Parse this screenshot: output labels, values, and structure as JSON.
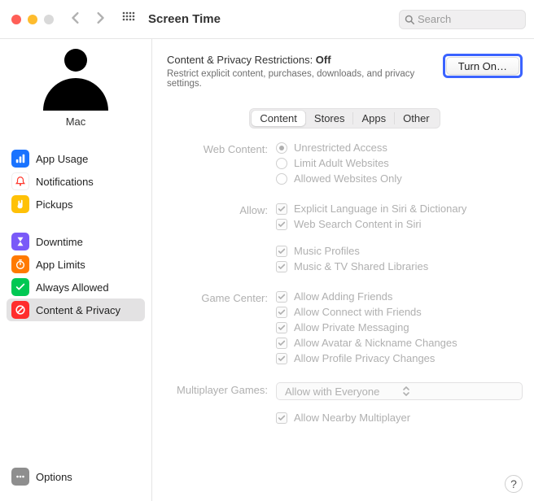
{
  "toolbar": {
    "title": "Screen Time",
    "search_placeholder": "Search"
  },
  "sidebar": {
    "user_name": "Mac",
    "groups": [
      [
        {
          "id": "app-usage",
          "label": "App Usage",
          "color": "#1a73ff",
          "icon": "bars"
        },
        {
          "id": "notifications",
          "label": "Notifications",
          "color": "#ffffff",
          "icon": "bell"
        },
        {
          "id": "pickups",
          "label": "Pickups",
          "color": "#ffc107",
          "icon": "hand"
        }
      ],
      [
        {
          "id": "downtime",
          "label": "Downtime",
          "color": "#7a5af8",
          "icon": "hourglass"
        },
        {
          "id": "app-limits",
          "label": "App Limits",
          "color": "#ff7a00",
          "icon": "timer"
        },
        {
          "id": "always-allowed",
          "label": "Always Allowed",
          "color": "#00c853",
          "icon": "check"
        },
        {
          "id": "content-privacy",
          "label": "Content & Privacy",
          "color": "#ff2d2d",
          "icon": "block",
          "selected": true
        }
      ]
    ],
    "footer": {
      "id": "options",
      "label": "Options",
      "color": "#8e8e8e",
      "icon": "ellipsis"
    }
  },
  "content": {
    "heading_prefix": "Content & Privacy Restrictions: ",
    "heading_status": "Off",
    "subheading": "Restrict explicit content, purchases, downloads, and privacy settings.",
    "turn_on_label": "Turn On…",
    "tabs": [
      "Content",
      "Stores",
      "Apps",
      "Other"
    ],
    "active_tab": 0,
    "sections": {
      "web_content": {
        "label": "Web Content:",
        "options": [
          "Unrestricted Access",
          "Limit Adult Websites",
          "Allowed Websites Only"
        ],
        "selected": 0
      },
      "allow": {
        "label": "Allow:",
        "group1": [
          "Explicit Language in Siri & Dictionary",
          "Web Search Content in Siri"
        ],
        "group2": [
          "Music Profiles",
          "Music & TV Shared Libraries"
        ]
      },
      "game_center": {
        "label": "Game Center:",
        "options": [
          "Allow Adding Friends",
          "Allow Connect with Friends",
          "Allow Private Messaging",
          "Allow Avatar & Nickname Changes",
          "Allow Profile Privacy Changes"
        ]
      },
      "multiplayer": {
        "label": "Multiplayer Games:",
        "popup_value": "Allow with Everyone",
        "nearby": "Allow Nearby Multiplayer"
      }
    },
    "help_text": "?"
  }
}
